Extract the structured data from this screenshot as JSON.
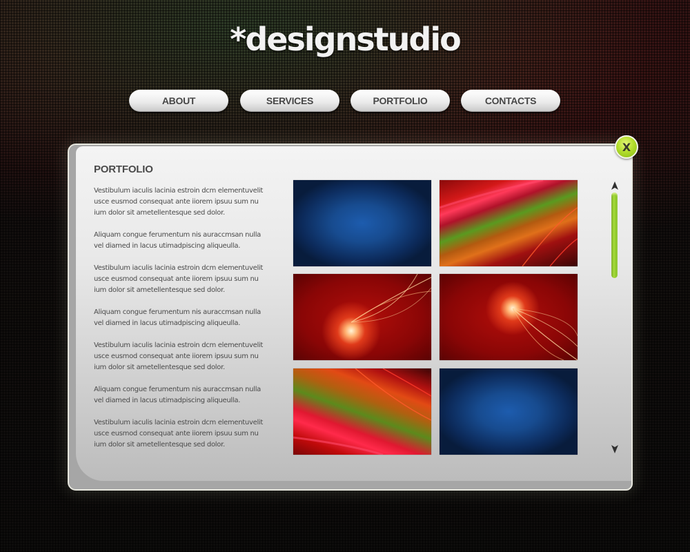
{
  "brand": {
    "logo_text": "*designstudio"
  },
  "nav": {
    "items": [
      {
        "label": "ABOUT"
      },
      {
        "label": "SERVICES"
      },
      {
        "label": "PORTFOLIO"
      },
      {
        "label": "CONTACTS"
      }
    ]
  },
  "panel": {
    "title": "PORTFOLIO",
    "close_icon": "close-x-icon",
    "close_label": "X",
    "paragraphs": [
      "Vestibulum iaculis lacinia estroin dcm elementuvelit usce eusmod consequat ante iiorem ipsuu sum nu ium dolor sit ametellentesque sed dolor.",
      "Aliquam congue ferumentum nis auraccmsan nulla vel diamed in lacus utimadpiscing aliqueulla.",
      "Vestibulum iaculis lacinia estroin dcm elementuvelit usce eusmod consequat ante iiorem ipsuu sum nu ium dolor sit ametellentesque sed dolor.",
      "Aliquam congue ferumentum nis auraccmsan nulla vel diamed in lacus utimadpiscing aliqueulla.",
      "Vestibulum iaculis lacinia estroin dcm elementuvelit usce eusmod consequat ante iiorem ipsuu sum nu ium dolor sit ametellentesque sed dolor.",
      "Aliquam congue ferumentum nis auraccmsan nulla vel diamed in lacus utimadpiscing aliqueulla.",
      "Vestibulum iaculis lacinia estroin dcm elementuvelit usce eusmod consequat ante iiorem ipsuu sum nu ium dolor sit ametellentesque sed dolor."
    ],
    "gallery": [
      {
        "name": "blue-texture",
        "style": "blue"
      },
      {
        "name": "red-light-streaks",
        "style": "streak-a"
      },
      {
        "name": "red-glow-swirl-left",
        "style": "glow-l"
      },
      {
        "name": "red-glow-swirl-right",
        "style": "glow-r"
      },
      {
        "name": "red-light-streaks-2",
        "style": "streak-b"
      },
      {
        "name": "blue-texture-2",
        "style": "blue"
      }
    ],
    "scrollbar": {
      "up_icon": "arrow-up-icon",
      "down_icon": "arrow-down-icon",
      "accent_color": "#8cc72a"
    }
  },
  "colors": {
    "accent_green": "#b4de2e",
    "text_dark": "#4a4a4a"
  }
}
